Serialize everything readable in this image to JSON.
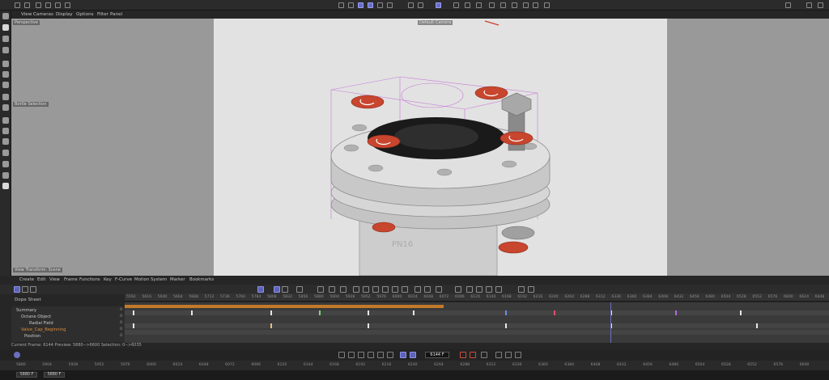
{
  "menubar": [
    "View",
    "Cameras",
    "Display",
    "Options",
    "Filter",
    "Panel"
  ],
  "viewport": {
    "camera_label": "Perspective",
    "hud_left": "Bottle Selection",
    "hud_bottom": "View Transform: Scene",
    "hud_top": "Default Camera"
  },
  "timeline_menu": [
    "Create",
    "Edit",
    "View",
    "Frame",
    "Functions",
    "Key",
    "F-Curve",
    "Motion System",
    "Marker",
    "Bookmarks"
  ],
  "sheet_title": "Dope Sheet",
  "tracks": [
    {
      "label": "Summary",
      "value": "0"
    },
    {
      "label": "Octane Object",
      "value": "0"
    },
    {
      "label": "Radial Field",
      "value": "0"
    },
    {
      "label": "Valve_Cap_Beginning",
      "value": "0"
    },
    {
      "label": "Position",
      "value": "0"
    }
  ],
  "status_text": "Current Frame: 6144  Preview: 5880-->6600  Selection: 0-->6035",
  "ruler_top": [
    "5592",
    "5616",
    "5640",
    "5664",
    "5688",
    "5712",
    "5736",
    "5760",
    "5784",
    "5808",
    "5832",
    "5856",
    "5880",
    "5904",
    "5928",
    "5952",
    "5976",
    "6000",
    "6024",
    "6048",
    "6072",
    "6096",
    "6120",
    "6144",
    "6168",
    "6192",
    "6216",
    "6240",
    "6264",
    "6288",
    "6312",
    "6336",
    "6360",
    "6384",
    "6408",
    "6432",
    "6456",
    "6480",
    "6504",
    "6528",
    "6552",
    "6576",
    "6600",
    "6624",
    "6648"
  ],
  "ruler_bottom": [
    "5880",
    "5904",
    "5928",
    "5952",
    "5976",
    "6000",
    "6024",
    "6048",
    "6072",
    "6096",
    "6120",
    "6144",
    "6168",
    "6192",
    "6216",
    "6240",
    "6264",
    "6288",
    "6312",
    "6336",
    "6360",
    "6384",
    "6408",
    "6432",
    "6456",
    "6480",
    "6504",
    "6528",
    "6552",
    "6576",
    "6600"
  ],
  "current_frame": "6144 F",
  "range_start": "5880 F",
  "range_end": "5880 F",
  "colors": {
    "accent": "#6a6fbf",
    "key_orange": "#c27a2a",
    "cap_red": "#c8452e"
  }
}
